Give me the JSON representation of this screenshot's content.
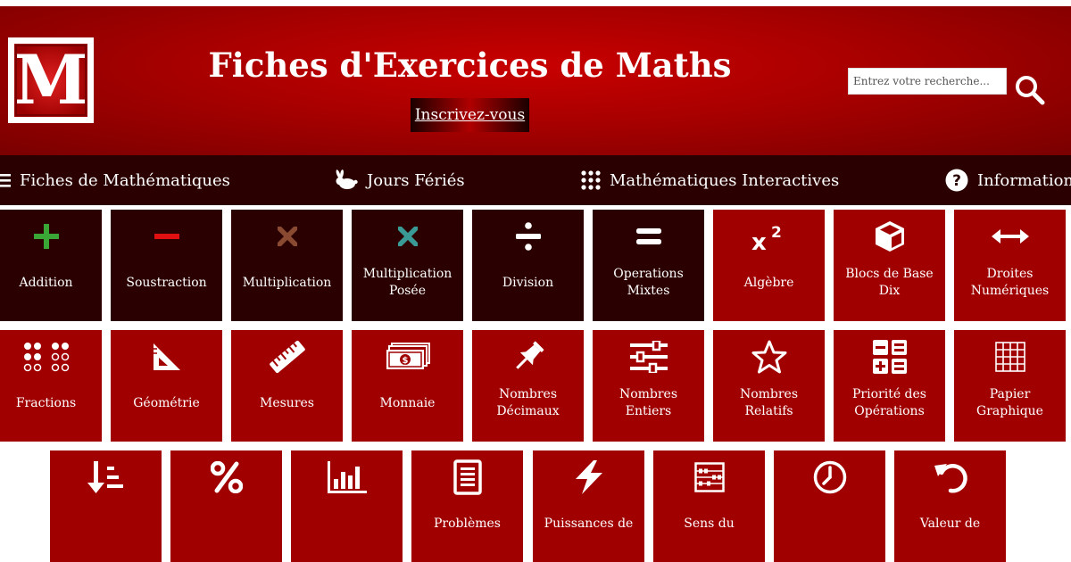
{
  "header": {
    "logo_letter": "M",
    "title": "Fiches d'Exercices de Maths",
    "signup_label": "Inscrivez-vous",
    "search_placeholder": "Entrez votre recherche..."
  },
  "nav": [
    {
      "label": "Fiches de Mathématiques",
      "icon": "menu-icon"
    },
    {
      "label": "Jours Fériés",
      "icon": "rabbit-icon"
    },
    {
      "label": "Mathématiques Interactives",
      "icon": "grid-dots-icon"
    },
    {
      "label": "Information",
      "icon": "question-circle-icon"
    }
  ],
  "tiles_row1": [
    {
      "label": "Addition",
      "icon": "plus-icon"
    },
    {
      "label": "Soustraction",
      "icon": "minus-icon"
    },
    {
      "label": "Multiplication",
      "icon": "times-icon"
    },
    {
      "label": "Multiplication Posée",
      "icon": "times-icon"
    },
    {
      "label": "Division",
      "icon": "divide-icon"
    },
    {
      "label": "Operations Mixtes",
      "icon": "equals-icon"
    },
    {
      "label": "Algèbre",
      "icon": "superscript-icon"
    },
    {
      "label": "Blocs de Base Dix",
      "icon": "cube-icon"
    },
    {
      "label": "Droites Numériques",
      "icon": "arrows-horizontal-icon"
    }
  ],
  "tiles_row2": [
    {
      "label": "Fractions",
      "icon": "fraction-dots-icon"
    },
    {
      "label": "Géométrie",
      "icon": "set-square-icon"
    },
    {
      "label": "Mesures",
      "icon": "ruler-icon"
    },
    {
      "label": "Monnaie",
      "icon": "money-icon"
    },
    {
      "label": "Nombres Décimaux",
      "icon": "thumbtack-icon"
    },
    {
      "label": "Nombres Entiers",
      "icon": "sliders-icon"
    },
    {
      "label": "Nombres Relatifs",
      "icon": "star-icon"
    },
    {
      "label": "Priorité des Opérations",
      "icon": "calculator-icon"
    },
    {
      "label": "Papier Graphique",
      "icon": "grid-icon"
    }
  ],
  "tiles_row3": [
    {
      "label": "",
      "icon": "sort-icon"
    },
    {
      "label": "",
      "icon": "percent-icon"
    },
    {
      "label": "",
      "icon": "bar-chart-icon"
    },
    {
      "label": "Problèmes",
      "icon": "document-icon"
    },
    {
      "label": "Puissances de",
      "icon": "lightning-icon"
    },
    {
      "label": "Sens du",
      "icon": "abacus-icon"
    },
    {
      "label": "",
      "icon": "clock-icon"
    },
    {
      "label": "Valeur de",
      "icon": "undo-icon"
    }
  ],
  "colors": {
    "header_red": "#a80000",
    "nav_dark": "#2a0000",
    "tile_dark": "#2a0000",
    "tile_red": "#a00000",
    "plus_green": "#3aa635",
    "minus_red": "#e01010",
    "times_brown": "#8a4a32",
    "times_teal": "#3a9a96"
  }
}
